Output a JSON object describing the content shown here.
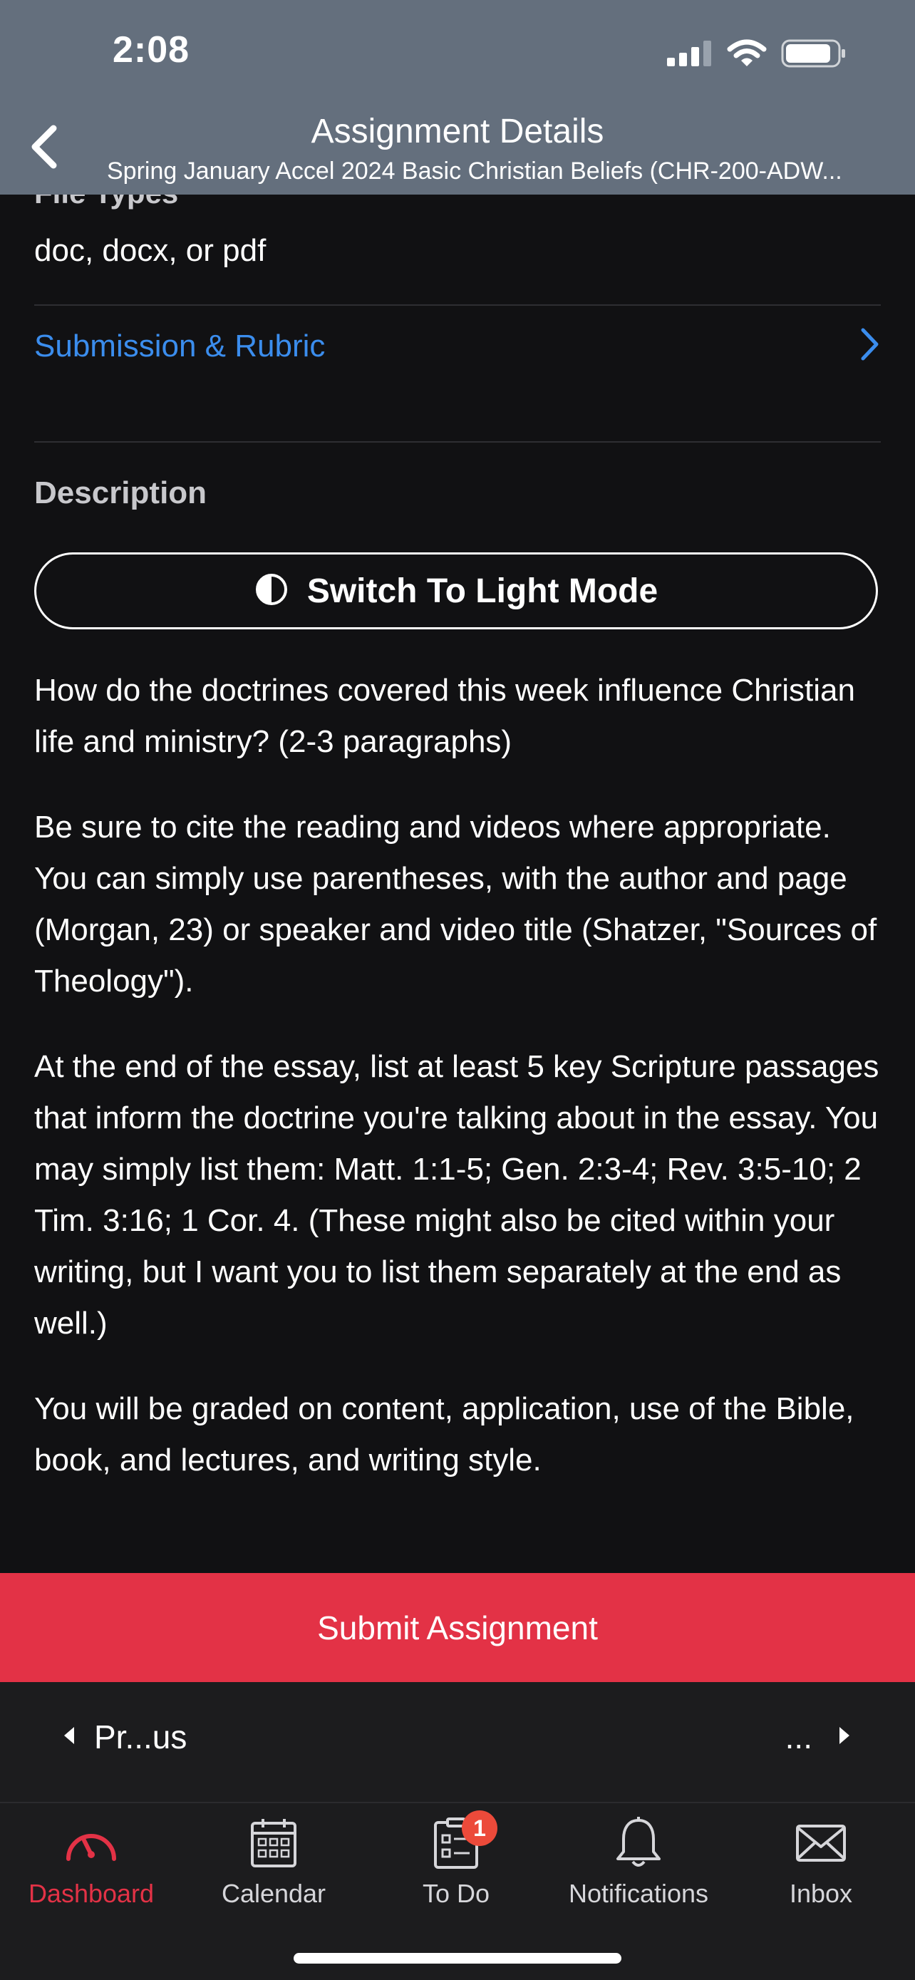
{
  "status_bar": {
    "time": "2:08",
    "icons": [
      "cellular-signal-icon",
      "wifi-icon",
      "battery-icon"
    ]
  },
  "header": {
    "title": "Assignment Details",
    "subtitle": "Spring January Accel 2024 Basic Christian Beliefs (CHR-200-ADW...",
    "back_icon": "chevron-left-icon"
  },
  "details": {
    "file_types_label": "File Types",
    "file_types_value": "doc, docx, or pdf",
    "submission_rubric_label": "Submission & Rubric",
    "description_label": "Description",
    "switch_mode_label": "Switch To Light Mode"
  },
  "description": {
    "paragraphs": [
      "How do the doctrines covered this week influence Christian life and ministry? (2-3 paragraphs)",
      "Be sure to cite the reading and videos where appropriate. You can simply use parentheses, with the author and page (Morgan, 23) or speaker and video title (Shatzer, \"Sources of Theology\").",
      "At the end of the essay, list at least 5 key Scripture passages that inform the doctrine you're talking about in the essay. You may simply list them: Matt. 1:1-5; Gen. 2:3-4; Rev. 3:5-10; 2 Tim. 3:16; 1 Cor. 4. (These might also be cited within your writing, but I want you to list them separately at the end as well.)",
      "You will be graded on content, application, use of the Bible, book, and lectures, and writing style."
    ]
  },
  "submit": {
    "label": "Submit Assignment"
  },
  "pager": {
    "prev_label": "Pr...us",
    "next_label": "..."
  },
  "tabbar": {
    "tabs": [
      {
        "label": "Dashboard",
        "icon": "dashboard-gauge-icon",
        "active": true
      },
      {
        "label": "Calendar",
        "icon": "calendar-icon",
        "active": false
      },
      {
        "label": "To Do",
        "icon": "todo-clipboard-icon",
        "active": false,
        "badge": "1"
      },
      {
        "label": "Notifications",
        "icon": "bell-icon",
        "active": false
      },
      {
        "label": "Inbox",
        "icon": "envelope-icon",
        "active": false
      }
    ]
  },
  "colors": {
    "header_bg": "#646f7d",
    "background": "#111113",
    "link_blue": "#3b8ded",
    "submit_red": "#e33246",
    "active_tab": "#e33246",
    "badge_red": "#ec4a3a"
  }
}
